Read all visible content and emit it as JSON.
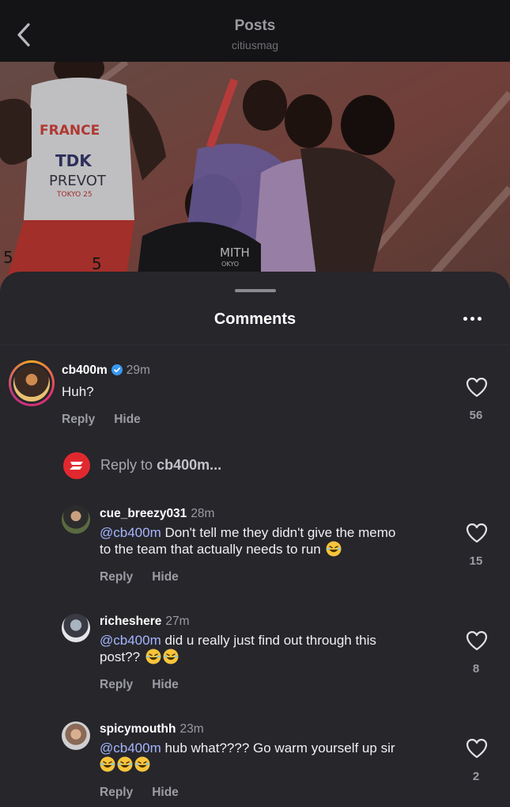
{
  "header": {
    "title": "Posts",
    "subtitle": "citiusmag",
    "back_icon": "chevron-left-icon"
  },
  "post_image": {
    "bib_lines": [
      "FRANCE",
      "TDK",
      "PREVOT",
      "TOKYO 25"
    ],
    "bib_number": "5",
    "other_text": [
      "MITH",
      "OKYO"
    ]
  },
  "comments_sheet": {
    "title": "Comments",
    "more_icon": "more-horizontal-icon"
  },
  "top_comment": {
    "username": "cb400m",
    "verified": true,
    "time": "29m",
    "text": "Huh?",
    "reply_label": "Reply",
    "hide_label": "Hide",
    "likes": "56"
  },
  "reply_box": {
    "placeholder_prefix": "Reply to",
    "placeholder_user": "cb400m..."
  },
  "replies": [
    {
      "username": "cue_breezy031",
      "time": "28m",
      "mention": "@cb400m",
      "text_line1": " Don't tell me they didn't give the memo",
      "text_line2": "to the team that actually needs to run",
      "emoji_count_line2": 1,
      "reply_label": "Reply",
      "hide_label": "Hide",
      "likes": "15"
    },
    {
      "username": "richeshere",
      "time": "27m",
      "mention": "@cb400m",
      "text_line1": " did u really just find out through this",
      "text_line2": "post??",
      "emoji_count_line2": 2,
      "reply_label": "Reply",
      "hide_label": "Hide",
      "likes": "8"
    },
    {
      "username": "spicymouthh",
      "time": "23m",
      "mention": "@cb400m",
      "text_line1": " hub what???? Go warm yourself up sir",
      "text_line2": "",
      "emoji_count_line2": 3,
      "reply_label": "Reply",
      "hide_label": "Hide",
      "likes": "2"
    }
  ],
  "colors": {
    "background": "#26262b",
    "topbar": "#141416",
    "mention": "#a6b6ff",
    "verified": "#3897f0"
  }
}
